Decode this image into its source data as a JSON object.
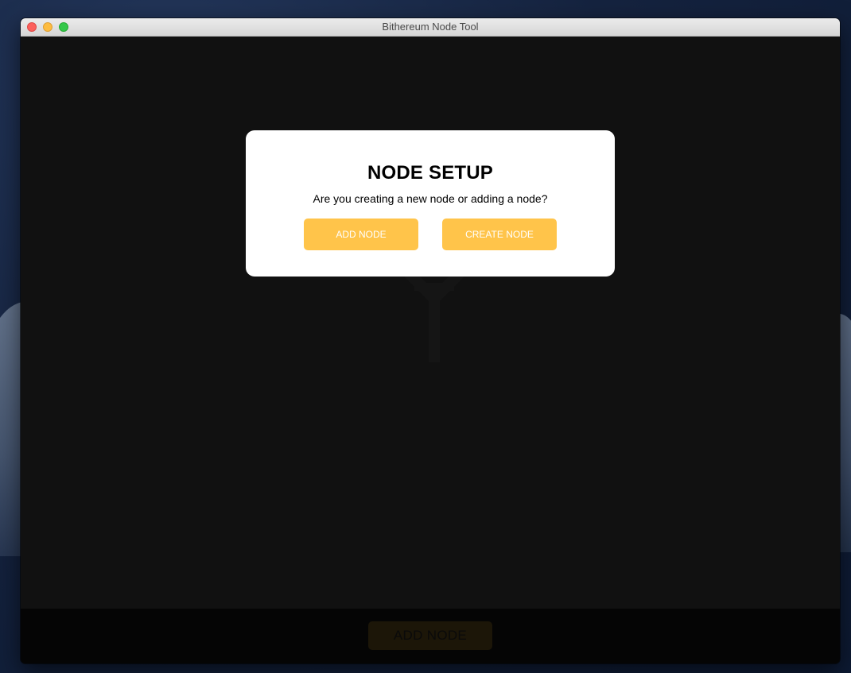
{
  "window": {
    "title": "Bithereum Node Tool"
  },
  "modal": {
    "title": "NODE SETUP",
    "subtitle": "Are you creating a new node or adding a node?",
    "add_button": "ADD NODE",
    "create_button": "CREATE NODE"
  },
  "footer": {
    "add_button": "ADD NODE"
  },
  "colors": {
    "accent": "#ffc44a",
    "app_background": "#111111",
    "footer_background": "#050505",
    "modal_background": "#ffffff"
  }
}
